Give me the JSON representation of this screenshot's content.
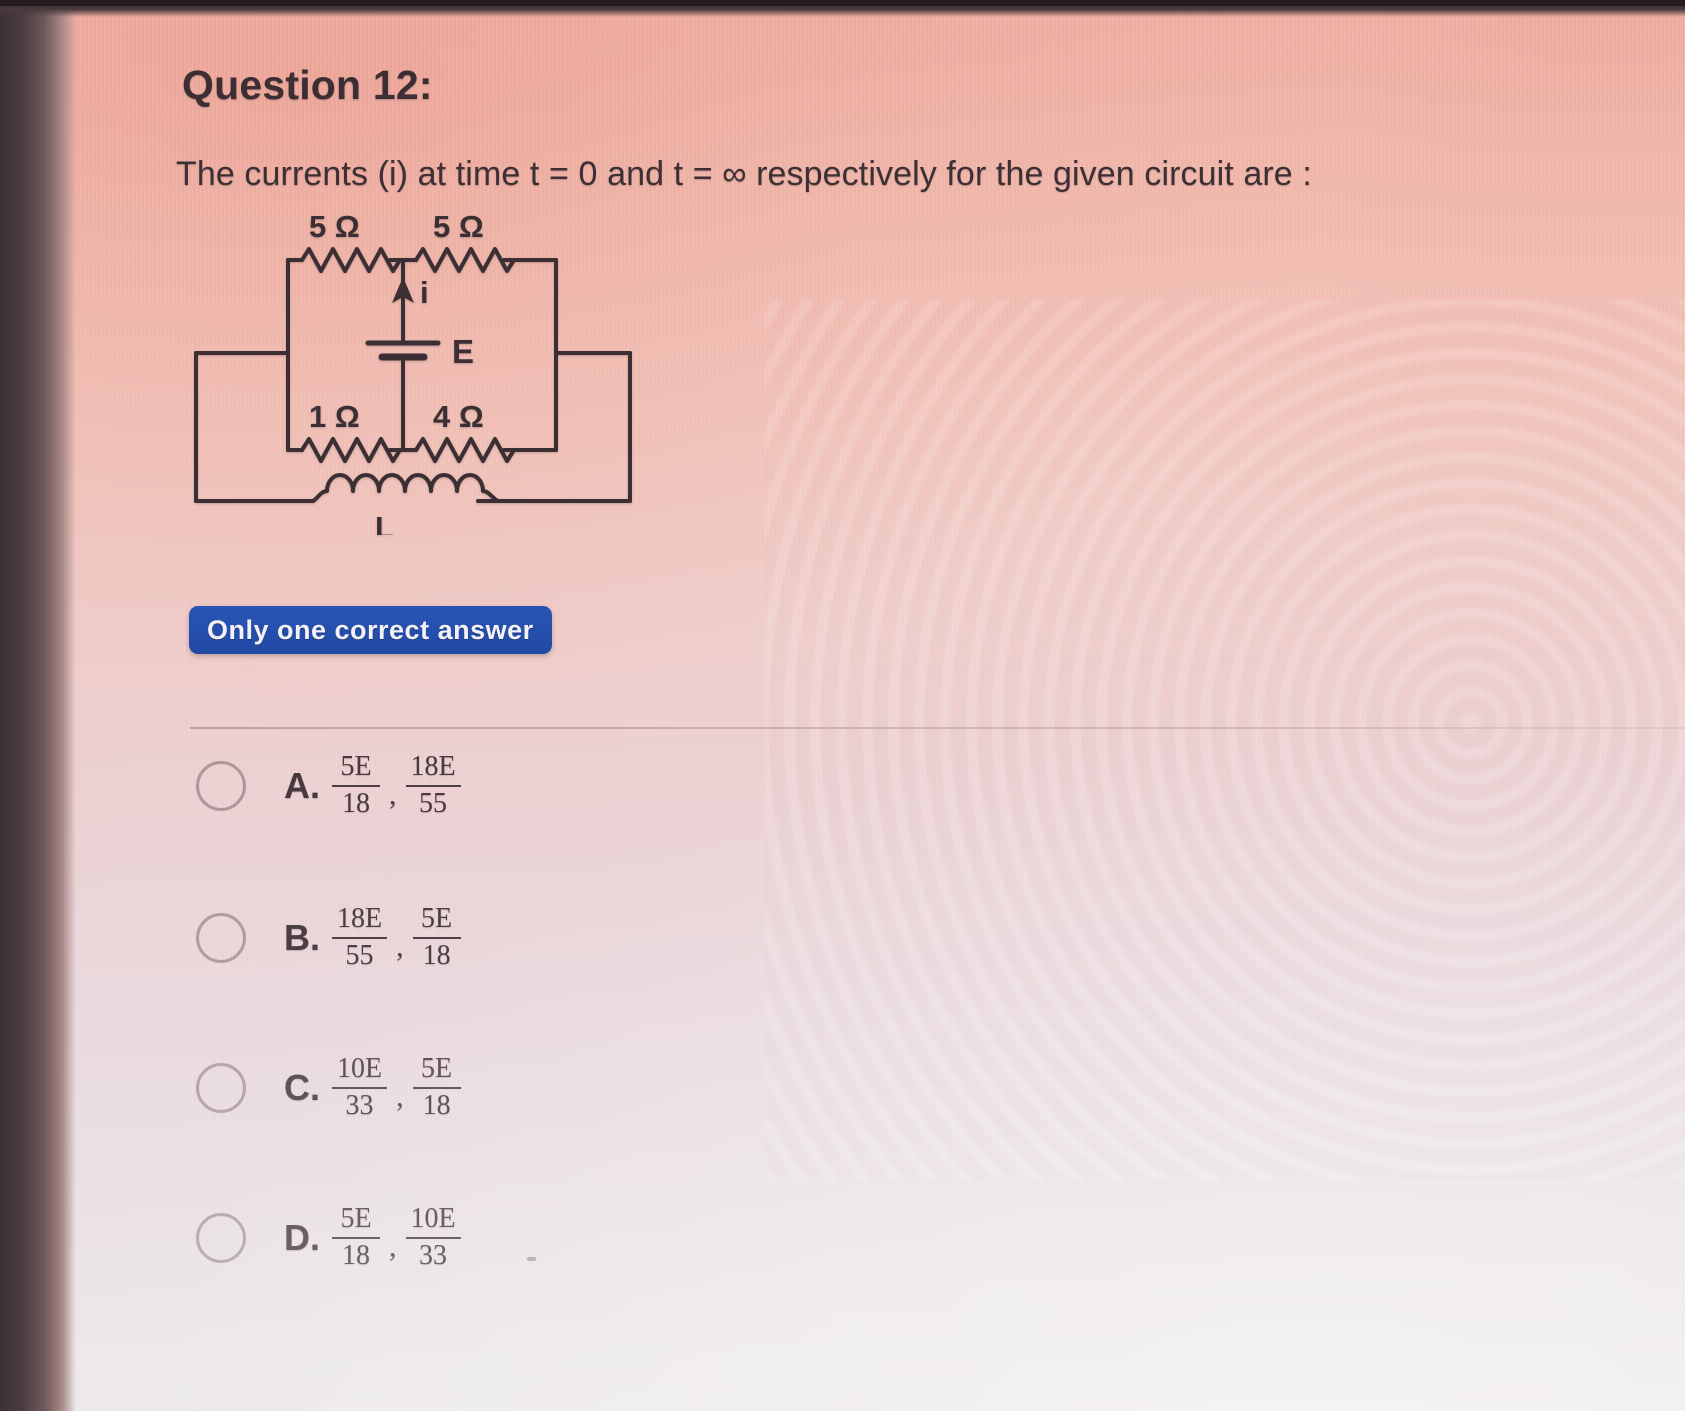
{
  "page": {
    "question_label": "Question 12:",
    "question_text": "The currents (i) at time t = 0 and t = ∞ respectively for the given circuit are :",
    "badge_label": "Only one correct answer",
    "accent_blue": "#2550ae",
    "background_top": "#f0b3a8",
    "background_bottom": "#eeeaec",
    "ink_color": "#3d3034"
  },
  "circuit": {
    "caption": "Wheatstone-style bridge with battery E and inductor L",
    "resistors": [
      {
        "id": "r-top-left",
        "label": "5 Ω",
        "value": 5,
        "unit": "Ω",
        "position": "top-left"
      },
      {
        "id": "r-top-right",
        "label": "5 Ω",
        "value": 5,
        "unit": "Ω",
        "position": "top-right"
      },
      {
        "id": "r-bottom-left",
        "label": "1 Ω",
        "value": 1,
        "unit": "Ω",
        "position": "bottom-left"
      },
      {
        "id": "r-bottom-right",
        "label": "4 Ω",
        "value": 4,
        "unit": "Ω",
        "position": "bottom-right"
      }
    ],
    "battery_label": "E",
    "current_label": "i",
    "inductor_label": "L"
  },
  "options": [
    {
      "letter": "A.",
      "selected": false,
      "first": {
        "numerator": "5E",
        "denominator": "18"
      },
      "second": {
        "numerator": "18E",
        "denominator": "55"
      }
    },
    {
      "letter": "B.",
      "selected": false,
      "first": {
        "numerator": "18E",
        "denominator": "55"
      },
      "second": {
        "numerator": "5E",
        "denominator": "18"
      }
    },
    {
      "letter": "C.",
      "selected": false,
      "first": {
        "numerator": "10E",
        "denominator": "33"
      },
      "second": {
        "numerator": "5E",
        "denominator": "18"
      }
    },
    {
      "letter": "D.",
      "selected": false,
      "first": {
        "numerator": "5E",
        "denominator": "18"
      },
      "second": {
        "numerator": "10E",
        "denominator": "33"
      }
    }
  ],
  "separator": ","
}
